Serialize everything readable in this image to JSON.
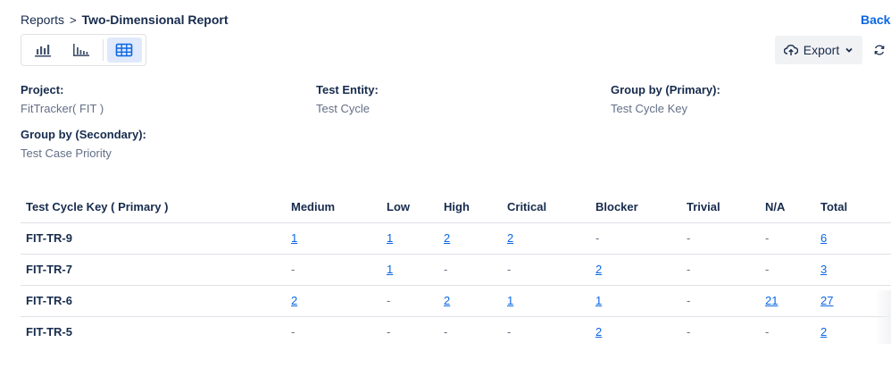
{
  "breadcrumb": {
    "parent": "Reports",
    "separator": ">",
    "current": "Two-Dimensional Report"
  },
  "back_label": "Back",
  "view_toggle": {
    "options": [
      {
        "icon": "bar-chart-icon",
        "active": false
      },
      {
        "icon": "histogram-chart-icon",
        "active": false
      },
      {
        "icon": "table-grid-icon",
        "active": true
      }
    ]
  },
  "export": {
    "label": "Export",
    "icon": "cloud-upload-icon",
    "caret_icon": "chevron-down-icon"
  },
  "refresh_icon": "refresh-icon",
  "meta": {
    "project": {
      "label": "Project:",
      "value": "FitTracker( FIT )"
    },
    "test_entity": {
      "label": "Test Entity:",
      "value": "Test Cycle"
    },
    "group_primary": {
      "label": "Group by (Primary):",
      "value": "Test Cycle Key"
    },
    "group_secondary": {
      "label": "Group by (Secondary):",
      "value": "Test Case Priority"
    }
  },
  "table": {
    "columns": [
      "Test Cycle Key ( Primary )",
      "Medium",
      "Low",
      "High",
      "Critical",
      "Blocker",
      "Trivial",
      "N/A",
      "Total"
    ],
    "rows": [
      {
        "key": "FIT-TR-9",
        "cells": [
          "1",
          "1",
          "2",
          "2",
          "-",
          "-",
          "-",
          "6"
        ]
      },
      {
        "key": "FIT-TR-7",
        "cells": [
          "-",
          "1",
          "-",
          "-",
          "2",
          "-",
          "-",
          "3"
        ]
      },
      {
        "key": "FIT-TR-6",
        "cells": [
          "2",
          "-",
          "2",
          "1",
          "1",
          "-",
          "21",
          "27"
        ]
      },
      {
        "key": "FIT-TR-5",
        "cells": [
          "-",
          "-",
          "-",
          "-",
          "2",
          "-",
          "-",
          "2"
        ]
      }
    ]
  },
  "colors": {
    "link": "#0c66e4",
    "text": "#172b4d",
    "muted": "#626f86",
    "active_toggle_bg": "#dfe9fb",
    "export_bg": "#f1f2f4"
  }
}
